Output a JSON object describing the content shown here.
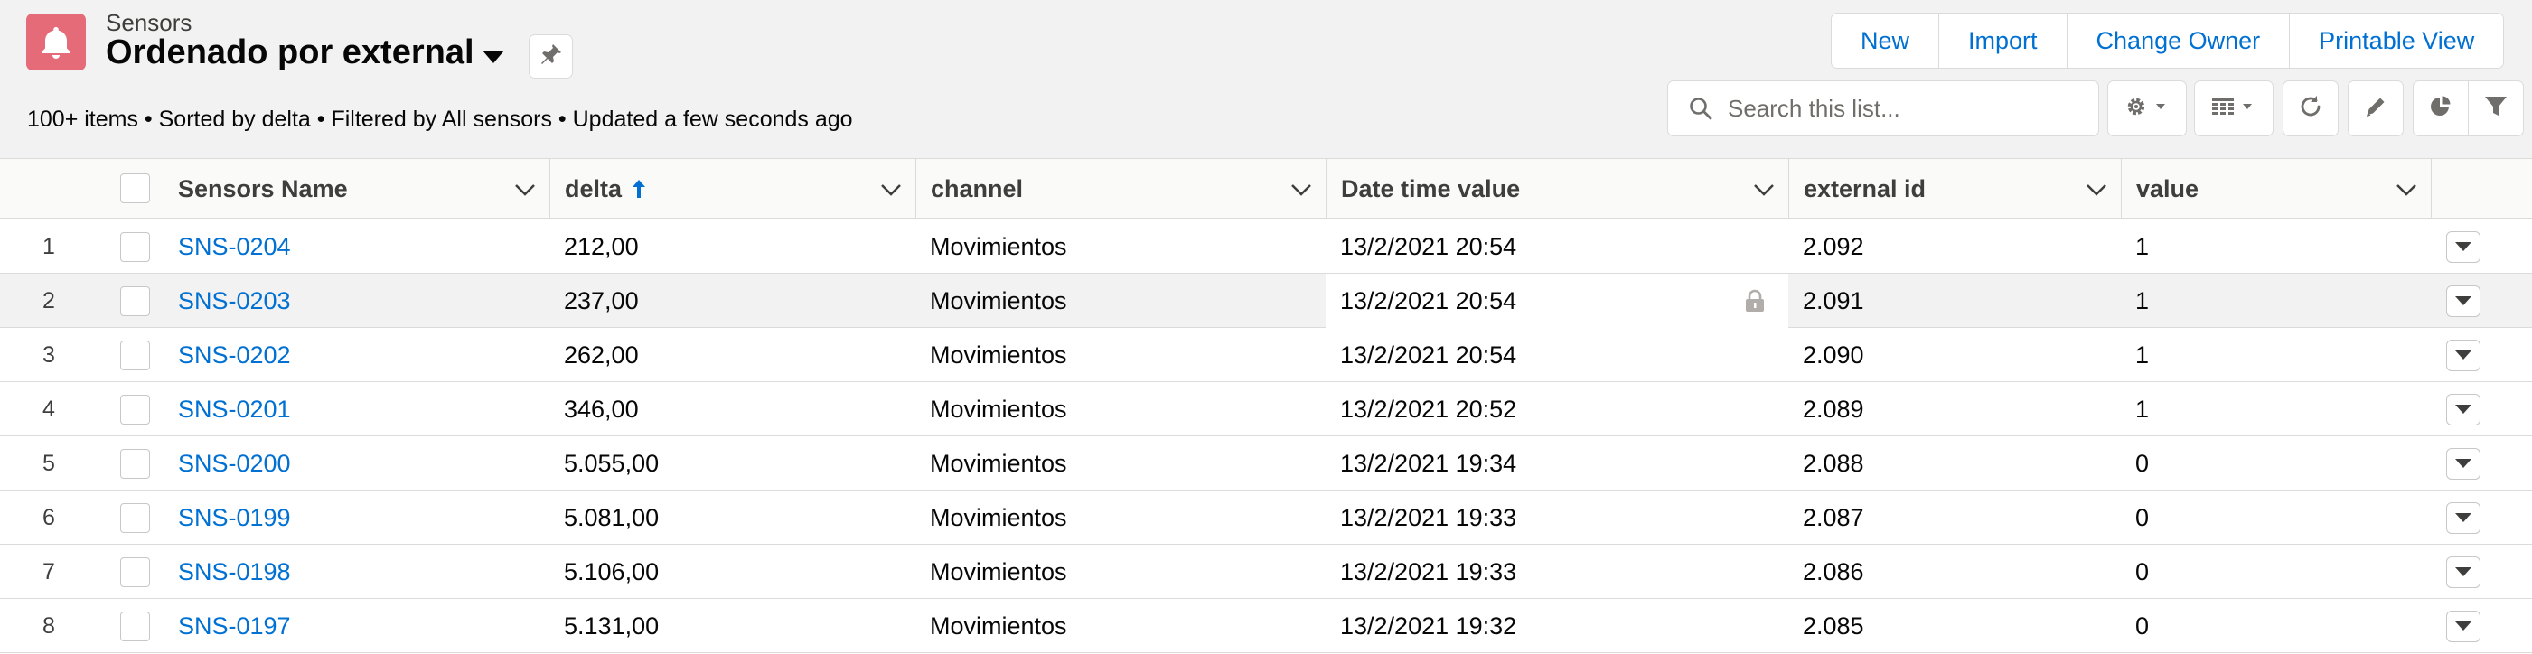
{
  "header": {
    "object_label": "Sensors",
    "list_title": "Ordenado por external",
    "meta": "100+ items • Sorted by delta • Filtered by All sensors • Updated a few seconds ago",
    "accent_color": "#e56b79"
  },
  "buttons": {
    "new": "New",
    "import": "Import",
    "change_owner": "Change Owner",
    "printable_view": "Printable View"
  },
  "search": {
    "placeholder": "Search this list..."
  },
  "toolbar_icons": [
    "gear-icon",
    "table-icon",
    "refresh-icon",
    "pencil-icon",
    "pie-chart-icon",
    "filter-icon"
  ],
  "columns": [
    {
      "label": "Sensors Name",
      "sorted": false
    },
    {
      "label": "delta",
      "sorted": true,
      "direction": "ascending"
    },
    {
      "label": "channel",
      "sorted": false
    },
    {
      "label": "Date time value",
      "sorted": false
    },
    {
      "label": "external id",
      "sorted": false
    },
    {
      "label": "value",
      "sorted": false
    }
  ],
  "rows": [
    {
      "num": "1",
      "name": "SNS-0204",
      "delta": "212,00",
      "channel": "Movimientos",
      "datetime": "13/2/2021 20:54",
      "external_id": "2.092",
      "value": "1"
    },
    {
      "num": "2",
      "name": "SNS-0203",
      "delta": "237,00",
      "channel": "Movimientos",
      "datetime": "13/2/2021 20:54",
      "external_id": "2.091",
      "value": "1"
    },
    {
      "num": "3",
      "name": "SNS-0202",
      "delta": "262,00",
      "channel": "Movimientos",
      "datetime": "13/2/2021 20:54",
      "external_id": "2.090",
      "value": "1"
    },
    {
      "num": "4",
      "name": "SNS-0201",
      "delta": "346,00",
      "channel": "Movimientos",
      "datetime": "13/2/2021 20:52",
      "external_id": "2.089",
      "value": "1"
    },
    {
      "num": "5",
      "name": "SNS-0200",
      "delta": "5.055,00",
      "channel": "Movimientos",
      "datetime": "13/2/2021 19:34",
      "external_id": "2.088",
      "value": "0"
    },
    {
      "num": "6",
      "name": "SNS-0199",
      "delta": "5.081,00",
      "channel": "Movimientos",
      "datetime": "13/2/2021 19:33",
      "external_id": "2.087",
      "value": "0"
    },
    {
      "num": "7",
      "name": "SNS-0198",
      "delta": "5.106,00",
      "channel": "Movimientos",
      "datetime": "13/2/2021 19:33",
      "external_id": "2.086",
      "value": "0"
    },
    {
      "num": "8",
      "name": "SNS-0197",
      "delta": "5.131,00",
      "channel": "Movimientos",
      "datetime": "13/2/2021 19:32",
      "external_id": "2.085",
      "value": "0"
    }
  ]
}
